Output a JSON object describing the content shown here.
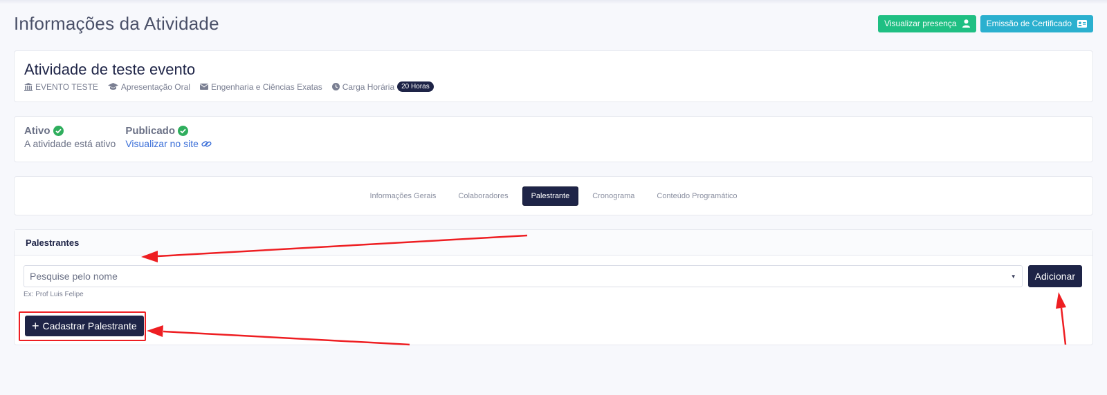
{
  "page": {
    "title": "Informações da Atividade",
    "actions": {
      "view_presence": "Visualizar presença",
      "certificate": "Emissão de Certificado"
    }
  },
  "activity": {
    "title": "Atividade de teste evento",
    "event": "EVENTO TESTE",
    "type": "Apresentação Oral",
    "area": "Engenharia e Ciências Exatas",
    "workload_label": "Carga Horária",
    "workload_value": "20 Horas"
  },
  "status": {
    "active_title": "Ativo",
    "active_sub": "A atividade está ativo",
    "published_title": "Publicado",
    "published_link": "Visualizar no site"
  },
  "tabs": [
    {
      "label": "Informações Gerais",
      "active": false
    },
    {
      "label": "Colaboradores",
      "active": false
    },
    {
      "label": "Palestrante",
      "active": true
    },
    {
      "label": "Cronograma",
      "active": false
    },
    {
      "label": "Conteúdo Programático",
      "active": false
    }
  ],
  "speakers": {
    "header": "Palestrantes",
    "search_placeholder": "Pesquise pelo nome",
    "hint": "Ex: Prof Luis Felipe",
    "add_button": "Adicionar",
    "register_button": "Cadastrar Palestrante"
  },
  "colors": {
    "primary": "#1e2447",
    "green": "#1fbf83",
    "cyan": "#2bb0cf",
    "check": "#2fae5d",
    "link": "#3b6fd8",
    "annotation": "#ee1e22"
  }
}
